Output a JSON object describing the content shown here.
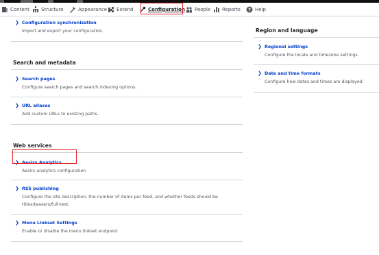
{
  "toolbar": {
    "items": [
      {
        "label": "Content",
        "icon": "content-icon"
      },
      {
        "label": "Structure",
        "icon": "structure-icon"
      },
      {
        "label": "Appearance",
        "icon": "appearance-icon"
      },
      {
        "label": "Extend",
        "icon": "extend-icon"
      },
      {
        "label": "Configuration",
        "icon": "configuration-icon",
        "active": true
      },
      {
        "label": "People",
        "icon": "people-icon"
      },
      {
        "label": "Reports",
        "icon": "reports-icon"
      },
      {
        "label": "Help",
        "icon": "help-icon"
      }
    ]
  },
  "left": {
    "top_item": {
      "link": "Configuration synchronization",
      "desc": "Import and export your configuration."
    },
    "search_metadata": {
      "title": "Search and metadata",
      "items": [
        {
          "link": "Search pages",
          "desc": "Configure search pages and search indexing options."
        },
        {
          "link": "URL aliases",
          "desc": "Add custom URLs to existing paths."
        }
      ]
    },
    "web_services": {
      "title": "Web services",
      "items": [
        {
          "link": "Aesirx Analytics",
          "desc": "Aesirx analytics configuration"
        },
        {
          "link": "RSS publishing",
          "desc": "Configure the site description, the number of items per feed, and whether feeds should be",
          "desc2": "titles/teasers/full-text."
        },
        {
          "link": "Menu Linkset Settings",
          "desc": "Enable or disable the menu linkset endpoint"
        }
      ]
    }
  },
  "right": {
    "region_language": {
      "title": "Region and language",
      "items": [
        {
          "link": "Regional settings",
          "desc": "Configure the locale and timezone settings."
        },
        {
          "link": "Date and time formats",
          "desc": "Configure how dates and times are displayed."
        }
      ]
    }
  },
  "colors": {
    "link": "#003ecc",
    "highlight": "#e3242b",
    "toolbar_bg": "#ffffff"
  }
}
